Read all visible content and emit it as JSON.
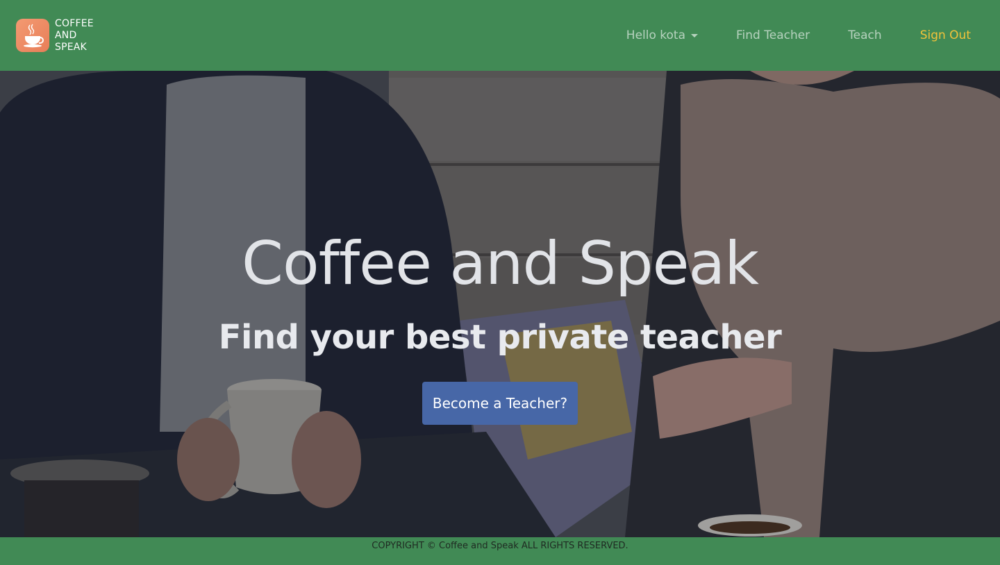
{
  "brand": {
    "logo_icon": "coffee-cup-icon",
    "line1": "COFFEE",
    "line2": "AND",
    "line3": "SPEAK"
  },
  "nav": {
    "user_menu": "Hello kota",
    "find_teacher": "Find Teacher",
    "teach": "Teach",
    "sign_out": "Sign Out"
  },
  "hero": {
    "title": "Coffee and Speak",
    "subtitle": "Find your best private teacher",
    "cta": "Become a Teacher?"
  },
  "footer": {
    "copyright": "COPYRIGHT © Coffee and Speak ALL RIGHTS RESERVED."
  },
  "colors": {
    "navbar": "#418a55",
    "sign_out": "#f2c33a",
    "cta": "#4767a7",
    "logo": "#f39a72"
  }
}
